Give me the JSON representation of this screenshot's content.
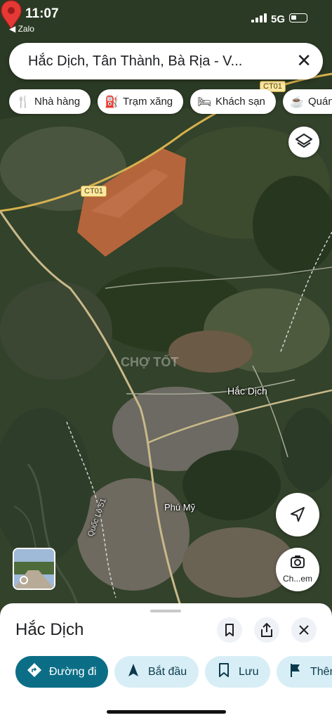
{
  "status_bar": {
    "time": "11:07",
    "back_app": "◀ Zalo",
    "network": "5G"
  },
  "search": {
    "query": "Hắc Dịch, Tân Thành, Bà Rịa - V...",
    "clear_icon": "close-icon"
  },
  "chips": [
    {
      "label": "Nhà hàng",
      "icon": "fork-knife-icon"
    },
    {
      "label": "Trạm xăng",
      "icon": "gas-pump-icon"
    },
    {
      "label": "Khách sạn",
      "icon": "bed-icon"
    },
    {
      "label": "Quán",
      "icon": "coffee-cup-icon"
    }
  ],
  "map": {
    "road_labels": [
      "CT01",
      "CT01",
      "Quốc Lộ 51"
    ],
    "place_labels": {
      "selected": "Hắc Dịch",
      "town": "Phú Mỹ",
      "watermark": "CHỢ TỐT"
    },
    "pin_color": "#e53935"
  },
  "controls": {
    "street_view_label": "Ch...em"
  },
  "sheet": {
    "title": "Hắc Dịch",
    "actions": [
      {
        "label": "Đường đi",
        "icon": "directions-icon"
      },
      {
        "label": "Bắt đầu",
        "icon": "navigation-arrow-icon"
      },
      {
        "label": "Lưu",
        "icon": "bookmark-icon"
      },
      {
        "label": "Thêm",
        "icon": "flag-icon"
      }
    ]
  },
  "colors": {
    "primary_action": "#0b6e86",
    "secondary_action": "#d8eef6",
    "accent_road": "#f2c94c"
  }
}
